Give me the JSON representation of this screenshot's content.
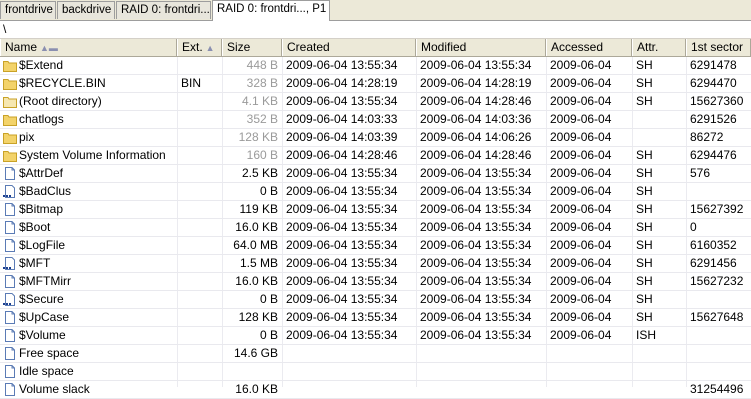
{
  "tabs": [
    {
      "label": "frontdrive",
      "active": false
    },
    {
      "label": "backdrive",
      "active": false
    },
    {
      "label": "RAID 0: frontdri...",
      "active": false
    },
    {
      "label": "RAID 0: frontdri..., P1",
      "active": true
    }
  ],
  "path": "\\",
  "columns": {
    "name": "Name",
    "ext": "Ext.",
    "size": "Size",
    "created": "Created",
    "modified": "Modified",
    "accessed": "Accessed",
    "attr": "Attr.",
    "first_sector": "1st sector"
  },
  "rows": [
    {
      "name": "$Extend",
      "icon": "folder-icon",
      "ext": "",
      "size": "448 B",
      "size_gray": true,
      "created": "2009-06-04  13:55:34",
      "modified": "2009-06-04  13:55:34",
      "accessed": "2009-06-04",
      "attr": "SH",
      "sector": "6291478"
    },
    {
      "name": "$RECYCLE.BIN",
      "icon": "folder-icon",
      "ext": "BIN",
      "size": "328 B",
      "size_gray": true,
      "created": "2009-06-04  14:28:19",
      "modified": "2009-06-04  14:28:19",
      "accessed": "2009-06-04",
      "attr": "SH",
      "sector": "6294470"
    },
    {
      "name": "(Root directory)",
      "icon": "root-folder-icon",
      "ext": "",
      "size": "4.1 KB",
      "size_gray": true,
      "created": "2009-06-04  13:55:34",
      "modified": "2009-06-04  14:28:46",
      "accessed": "2009-06-04",
      "attr": "SH",
      "sector": "15627360"
    },
    {
      "name": "chatlogs",
      "icon": "folder-icon",
      "ext": "",
      "size": "352 B",
      "size_gray": true,
      "created": "2009-06-04  14:03:33",
      "modified": "2009-06-04  14:03:36",
      "accessed": "2009-06-04",
      "attr": "",
      "sector": "6291526"
    },
    {
      "name": "pix",
      "icon": "folder-icon",
      "ext": "",
      "size": "128 KB",
      "size_gray": true,
      "created": "2009-06-04  14:03:39",
      "modified": "2009-06-04  14:06:26",
      "accessed": "2009-06-04",
      "attr": "",
      "sector": "86272"
    },
    {
      "name": "System Volume Information",
      "icon": "folder-icon",
      "ext": "",
      "size": "160 B",
      "size_gray": true,
      "created": "2009-06-04  14:28:46",
      "modified": "2009-06-04  14:28:46",
      "accessed": "2009-06-04",
      "attr": "SH",
      "sector": "6294476"
    },
    {
      "name": "$AttrDef",
      "icon": "file-icon",
      "ext": "",
      "size": "2.5 KB",
      "size_gray": false,
      "created": "2009-06-04  13:55:34",
      "modified": "2009-06-04  13:55:34",
      "accessed": "2009-06-04",
      "attr": "SH",
      "sector": "576"
    },
    {
      "name": "$BadClus",
      "icon": "sparse-file-icon",
      "ext": "",
      "size": "0 B",
      "size_gray": false,
      "created": "2009-06-04  13:55:34",
      "modified": "2009-06-04  13:55:34",
      "accessed": "2009-06-04",
      "attr": "SH",
      "sector": ""
    },
    {
      "name": "$Bitmap",
      "icon": "file-icon",
      "ext": "",
      "size": "119 KB",
      "size_gray": false,
      "created": "2009-06-04  13:55:34",
      "modified": "2009-06-04  13:55:34",
      "accessed": "2009-06-04",
      "attr": "SH",
      "sector": "15627392"
    },
    {
      "name": "$Boot",
      "icon": "file-icon",
      "ext": "",
      "size": "16.0 KB",
      "size_gray": false,
      "created": "2009-06-04  13:55:34",
      "modified": "2009-06-04  13:55:34",
      "accessed": "2009-06-04",
      "attr": "SH",
      "sector": "0"
    },
    {
      "name": "$LogFile",
      "icon": "file-icon",
      "ext": "",
      "size": "64.0 MB",
      "size_gray": false,
      "created": "2009-06-04  13:55:34",
      "modified": "2009-06-04  13:55:34",
      "accessed": "2009-06-04",
      "attr": "SH",
      "sector": "6160352"
    },
    {
      "name": "$MFT",
      "icon": "sparse-file-icon",
      "ext": "",
      "size": "1.5 MB",
      "size_gray": false,
      "created": "2009-06-04  13:55:34",
      "modified": "2009-06-04  13:55:34",
      "accessed": "2009-06-04",
      "attr": "SH",
      "sector": "6291456"
    },
    {
      "name": "$MFTMirr",
      "icon": "file-icon",
      "ext": "",
      "size": "16.0 KB",
      "size_gray": false,
      "created": "2009-06-04  13:55:34",
      "modified": "2009-06-04  13:55:34",
      "accessed": "2009-06-04",
      "attr": "SH",
      "sector": "15627232"
    },
    {
      "name": "$Secure",
      "icon": "sparse-file-icon",
      "ext": "",
      "size": "0 B",
      "size_gray": false,
      "created": "2009-06-04  13:55:34",
      "modified": "2009-06-04  13:55:34",
      "accessed": "2009-06-04",
      "attr": "SH",
      "sector": ""
    },
    {
      "name": "$UpCase",
      "icon": "file-icon",
      "ext": "",
      "size": "128 KB",
      "size_gray": false,
      "created": "2009-06-04  13:55:34",
      "modified": "2009-06-04  13:55:34",
      "accessed": "2009-06-04",
      "attr": "SH",
      "sector": "15627648"
    },
    {
      "name": "$Volume",
      "icon": "file-icon",
      "ext": "",
      "size": "0 B",
      "size_gray": false,
      "created": "2009-06-04  13:55:34",
      "modified": "2009-06-04  13:55:34",
      "accessed": "2009-06-04",
      "attr": "ISH",
      "sector": ""
    },
    {
      "name": "Free space",
      "icon": "file-icon",
      "ext": "",
      "size": "14.6 GB",
      "size_gray": false,
      "created": "",
      "modified": "",
      "accessed": "",
      "attr": "",
      "sector": ""
    },
    {
      "name": "Idle space",
      "icon": "file-icon",
      "ext": "",
      "size": "",
      "size_gray": false,
      "created": "",
      "modified": "",
      "accessed": "",
      "attr": "",
      "sector": ""
    },
    {
      "name": "Volume slack",
      "icon": "file-icon",
      "ext": "",
      "size": "16.0 KB",
      "size_gray": false,
      "created": "",
      "modified": "",
      "accessed": "",
      "attr": "",
      "sector": "31254496"
    }
  ],
  "colors": {
    "folder": "#f3d36a",
    "folder_stroke": "#c9a227",
    "file": "#ffffff",
    "file_stroke": "#5b7bb5",
    "selection_accent": "#316ac5"
  }
}
